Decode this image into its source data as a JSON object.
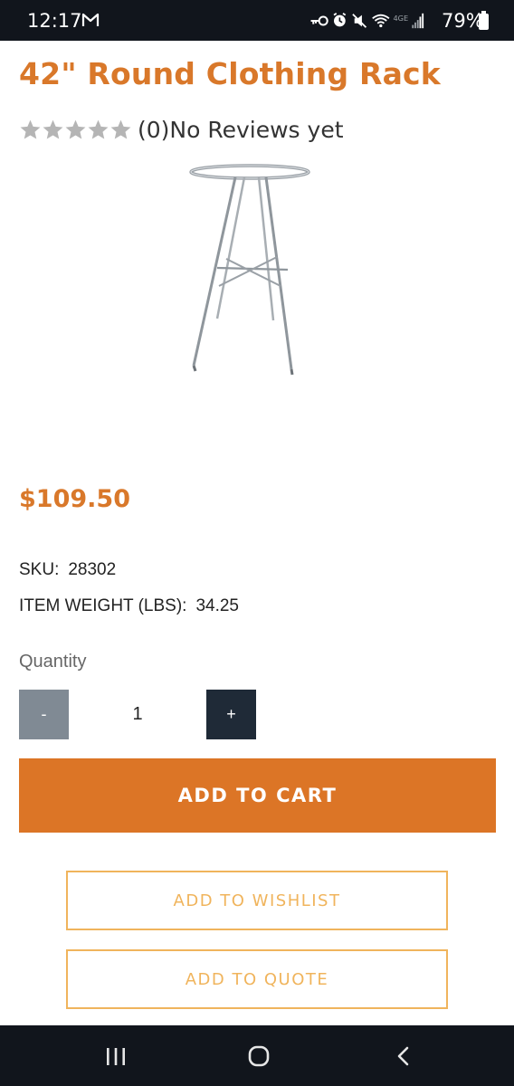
{
  "status_bar": {
    "time": "12:17",
    "network": "4GE",
    "battery": "79%"
  },
  "product": {
    "title": "42\" Round Clothing Rack",
    "rating": {
      "stars_filled": 0,
      "stars_total": 5,
      "text": "(0)No Reviews yet"
    },
    "price": "$109.50",
    "sku_label": "SKU:",
    "sku_value": "28302",
    "weight_label": "ITEM WEIGHT (LBS):",
    "weight_value": "34.25"
  },
  "quantity": {
    "label": "Quantity",
    "minus": "-",
    "value": "1",
    "plus": "+"
  },
  "actions": {
    "add_to_cart": "ADD TO CART",
    "add_to_wishlist": "ADD TO WISHLIST",
    "add_to_quote": "ADD TO QUOTE"
  },
  "colors": {
    "accent": "#dc7526",
    "outline": "#f0b45c",
    "plus_button": "#1f2a37",
    "minus_button": "#808a94",
    "star": "#b5b5b5"
  },
  "icons": [
    "mail-icon",
    "key-icon",
    "alarm-icon",
    "mute-icon",
    "wifi-icon",
    "signal-icon",
    "battery-icon",
    "star-icon",
    "recents-icon",
    "home-icon",
    "back-icon"
  ]
}
